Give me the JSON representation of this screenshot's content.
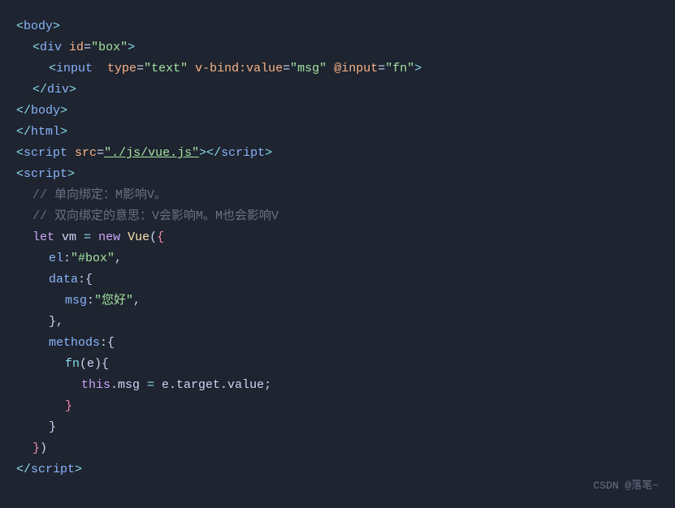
{
  "watermark": "CSDN @落笔~",
  "lines": [
    {
      "id": "l1",
      "tokens": [
        {
          "t": "<",
          "c": "c-bracket"
        },
        {
          "t": "body",
          "c": "c-tag"
        },
        {
          "t": ">",
          "c": "c-bracket"
        }
      ]
    },
    {
      "id": "l2",
      "indent": 1,
      "tokens": [
        {
          "t": "<",
          "c": "c-bracket"
        },
        {
          "t": "div",
          "c": "c-tag"
        },
        {
          "t": " ",
          "c": "c-plain"
        },
        {
          "t": "id",
          "c": "c-attr"
        },
        {
          "t": "=",
          "c": "c-punct"
        },
        {
          "t": "\"box\"",
          "c": "c-string"
        },
        {
          "t": ">",
          "c": "c-bracket"
        }
      ]
    },
    {
      "id": "l3",
      "indent": 2,
      "bar": true,
      "tokens": [
        {
          "t": "<",
          "c": "c-bracket"
        },
        {
          "t": "input",
          "c": "c-tag"
        },
        {
          "t": "  ",
          "c": "c-plain"
        },
        {
          "t": "type",
          "c": "c-attr"
        },
        {
          "t": "=",
          "c": "c-punct"
        },
        {
          "t": "\"text\"",
          "c": "c-string"
        },
        {
          "t": " ",
          "c": "c-plain"
        },
        {
          "t": "v-bind:value",
          "c": "c-attr"
        },
        {
          "t": "=",
          "c": "c-punct"
        },
        {
          "t": "\"msg\"",
          "c": "c-string"
        },
        {
          "t": " ",
          "c": "c-plain"
        },
        {
          "t": "@input",
          "c": "c-attr"
        },
        {
          "t": "=",
          "c": "c-punct"
        },
        {
          "t": "\"fn\"",
          "c": "c-string"
        },
        {
          "t": ">",
          "c": "c-bracket"
        }
      ]
    },
    {
      "id": "l4",
      "indent": 1,
      "tokens": [
        {
          "t": "</",
          "c": "c-bracket"
        },
        {
          "t": "div",
          "c": "c-tag"
        },
        {
          "t": ">",
          "c": "c-bracket"
        }
      ]
    },
    {
      "id": "l5",
      "tokens": [
        {
          "t": "</",
          "c": "c-bracket"
        },
        {
          "t": "body",
          "c": "c-tag"
        },
        {
          "t": ">",
          "c": "c-bracket"
        }
      ]
    },
    {
      "id": "l6",
      "tokens": [
        {
          "t": "</",
          "c": "c-bracket"
        },
        {
          "t": "html",
          "c": "c-tag"
        },
        {
          "t": ">",
          "c": "c-bracket"
        }
      ]
    },
    {
      "id": "l7",
      "tokens": [
        {
          "t": "<",
          "c": "c-bracket"
        },
        {
          "t": "script",
          "c": "c-tag"
        },
        {
          "t": " ",
          "c": "c-plain"
        },
        {
          "t": "src",
          "c": "c-attr"
        },
        {
          "t": "=",
          "c": "c-punct"
        },
        {
          "t": "\"./js/vue.js\"",
          "c": "c-string-url"
        },
        {
          "t": "></",
          "c": "c-bracket"
        },
        {
          "t": "script",
          "c": "c-tag"
        },
        {
          "t": ">",
          "c": "c-bracket"
        }
      ]
    },
    {
      "id": "l8",
      "tokens": [
        {
          "t": "<",
          "c": "c-bracket"
        },
        {
          "t": "script",
          "c": "c-tag"
        },
        {
          "t": ">",
          "c": "c-bracket"
        }
      ]
    },
    {
      "id": "l9",
      "indent": 1,
      "tokens": [
        {
          "t": "// 单向绑定：M影响V。",
          "c": "c-comment-zh"
        }
      ]
    },
    {
      "id": "l10",
      "indent": 1,
      "tokens": [
        {
          "t": "// 双向绑定的意思：V会影响M。M也会影响V",
          "c": "c-comment-zh"
        }
      ]
    },
    {
      "id": "l11",
      "indent": 1,
      "tokens": [
        {
          "t": "let",
          "c": "c-keyword"
        },
        {
          "t": " vm ",
          "c": "c-plain"
        },
        {
          "t": "=",
          "c": "c-op"
        },
        {
          "t": " ",
          "c": "c-plain"
        },
        {
          "t": "new",
          "c": "c-keyword"
        },
        {
          "t": " ",
          "c": "c-plain"
        },
        {
          "t": "Vue",
          "c": "c-class"
        },
        {
          "t": "(",
          "c": "c-punct"
        },
        {
          "t": "{",
          "c": "c-value"
        }
      ]
    },
    {
      "id": "l12",
      "indent": 2,
      "bar2": true,
      "tokens": [
        {
          "t": "el",
          "c": "c-key"
        },
        {
          "t": ":",
          "c": "c-punct"
        },
        {
          "t": "\"#box\"",
          "c": "c-str-val"
        },
        {
          "t": ",",
          "c": "c-punct"
        }
      ]
    },
    {
      "id": "l13",
      "indent": 2,
      "bar2": true,
      "tokens": [
        {
          "t": "data",
          "c": "c-key"
        },
        {
          "t": ":",
          "c": "c-punct"
        },
        {
          "t": "{",
          "c": "c-punct"
        }
      ]
    },
    {
      "id": "l14",
      "indent": 3,
      "bar2": true,
      "bar3": true,
      "tokens": [
        {
          "t": "msg",
          "c": "c-key"
        },
        {
          "t": ":",
          "c": "c-punct"
        },
        {
          "t": "\"您好\"",
          "c": "c-str-val"
        },
        {
          "t": ",",
          "c": "c-punct"
        }
      ]
    },
    {
      "id": "l15",
      "indent": 2,
      "bar2": true,
      "tokens": [
        {
          "t": "},",
          "c": "c-punct"
        }
      ]
    },
    {
      "id": "l16",
      "indent": 2,
      "bar2": true,
      "tokens": [
        {
          "t": "methods",
          "c": "c-key"
        },
        {
          "t": ":",
          "c": "c-punct"
        },
        {
          "t": "{",
          "c": "c-punct"
        }
      ]
    },
    {
      "id": "l17",
      "indent": 3,
      "bar2": true,
      "bar3": true,
      "tokens": [
        {
          "t": "fn",
          "c": "c-fn"
        },
        {
          "t": "(e)",
          "c": "c-punct"
        },
        {
          "t": "{",
          "c": "c-punct"
        }
      ]
    },
    {
      "id": "l18",
      "indent": 4,
      "bar2": true,
      "bar3": true,
      "bar4": true,
      "tokens": [
        {
          "t": "this",
          "c": "c-keyword"
        },
        {
          "t": ".msg ",
          "c": "c-plain"
        },
        {
          "t": "=",
          "c": "c-op"
        },
        {
          "t": " e.target.value",
          "c": "c-plain"
        },
        {
          "t": ";",
          "c": "c-punct"
        }
      ]
    },
    {
      "id": "l19",
      "indent": 3,
      "bar2": true,
      "bar3": true,
      "tokens": [
        {
          "t": "}",
          "c": "c-value"
        }
      ]
    },
    {
      "id": "l20",
      "indent": 2,
      "bar2": true,
      "tokens": [
        {
          "t": "}",
          "c": "c-punct"
        }
      ]
    },
    {
      "id": "l21",
      "indent": 1,
      "tokens": [
        {
          "t": "}",
          "c": "c-value"
        },
        {
          "t": ")",
          "c": "c-punct"
        }
      ]
    },
    {
      "id": "l22",
      "tokens": [
        {
          "t": "</",
          "c": "c-bracket"
        },
        {
          "t": "script",
          "c": "c-tag"
        },
        {
          "t": ">",
          "c": "c-bracket"
        }
      ]
    }
  ]
}
